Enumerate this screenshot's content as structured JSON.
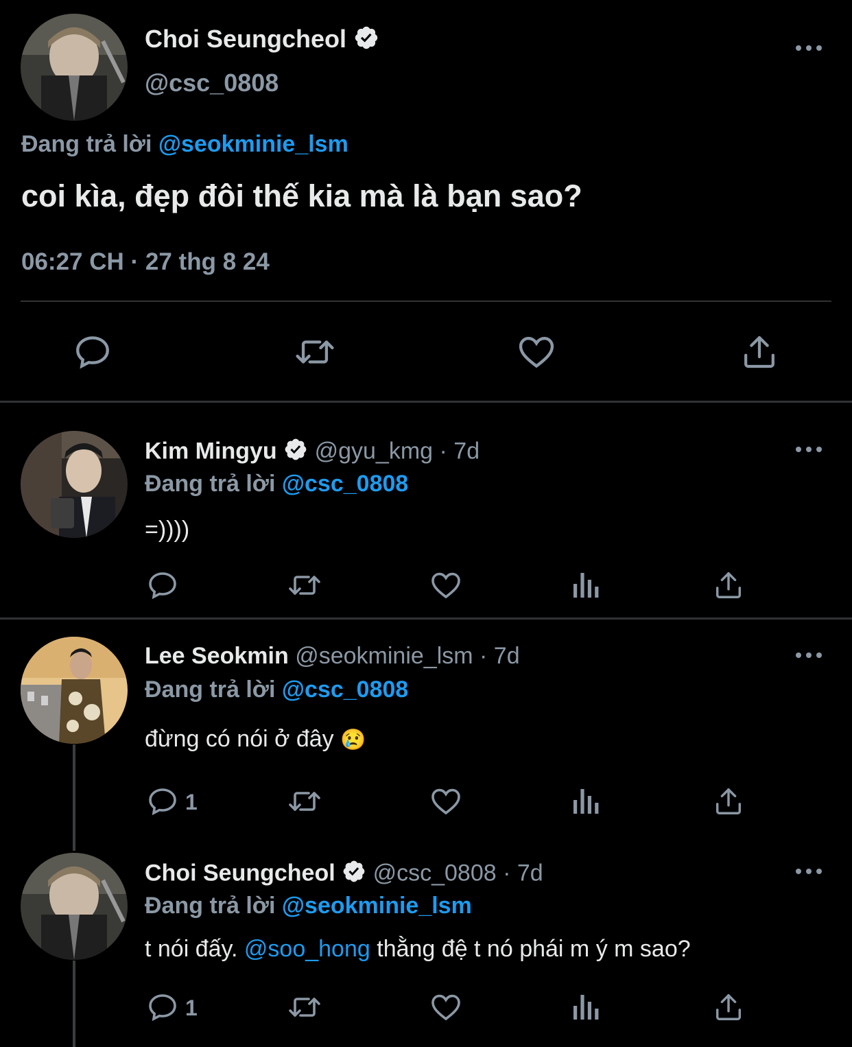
{
  "main_tweet": {
    "name": "Choi Seungcheol",
    "handle": "@csc_0808",
    "reply_prefix": "Đang trả lời",
    "reply_to": "@seokminie_lsm",
    "text": "coi kìa, đẹp đôi thế kia mà là bạn sao?",
    "timestamp": "06:27 CH · 27 thg 8 24"
  },
  "replies": [
    {
      "name": "Kim Mingyu",
      "handle": "@gyu_kmg",
      "time": "· 7d",
      "reply_prefix": "Đang trả lời",
      "reply_to": "@csc_0808",
      "text": "=))))",
      "reply_count": ""
    },
    {
      "name": "Lee Seokmin",
      "handle": "@seokminie_lsm",
      "time": "· 7d",
      "reply_prefix": "Đang trả lời",
      "reply_to": "@csc_0808",
      "text": "đừng có nói ở đây",
      "emoji": "😢",
      "reply_count": "1"
    },
    {
      "name": "Choi Seungcheol",
      "handle": "@csc_0808",
      "time": "· 7d",
      "reply_prefix": "Đang trả lời",
      "reply_to": "@seokminie_lsm",
      "text_before": "t nói đấy.",
      "mention": "@soo_hong",
      "text_after": "thằng đệ t nó phái m ý m sao?",
      "reply_count": "1"
    }
  ],
  "colors": {
    "background": "#000000",
    "text": "#e7e9ea",
    "secondary": "#8b98a5",
    "link": "#1d9bf0",
    "divider": "#2f3336"
  },
  "icons": [
    "reply-icon",
    "retweet-icon",
    "like-icon",
    "share-icon",
    "analytics-icon",
    "more-icon",
    "verified-icon"
  ]
}
